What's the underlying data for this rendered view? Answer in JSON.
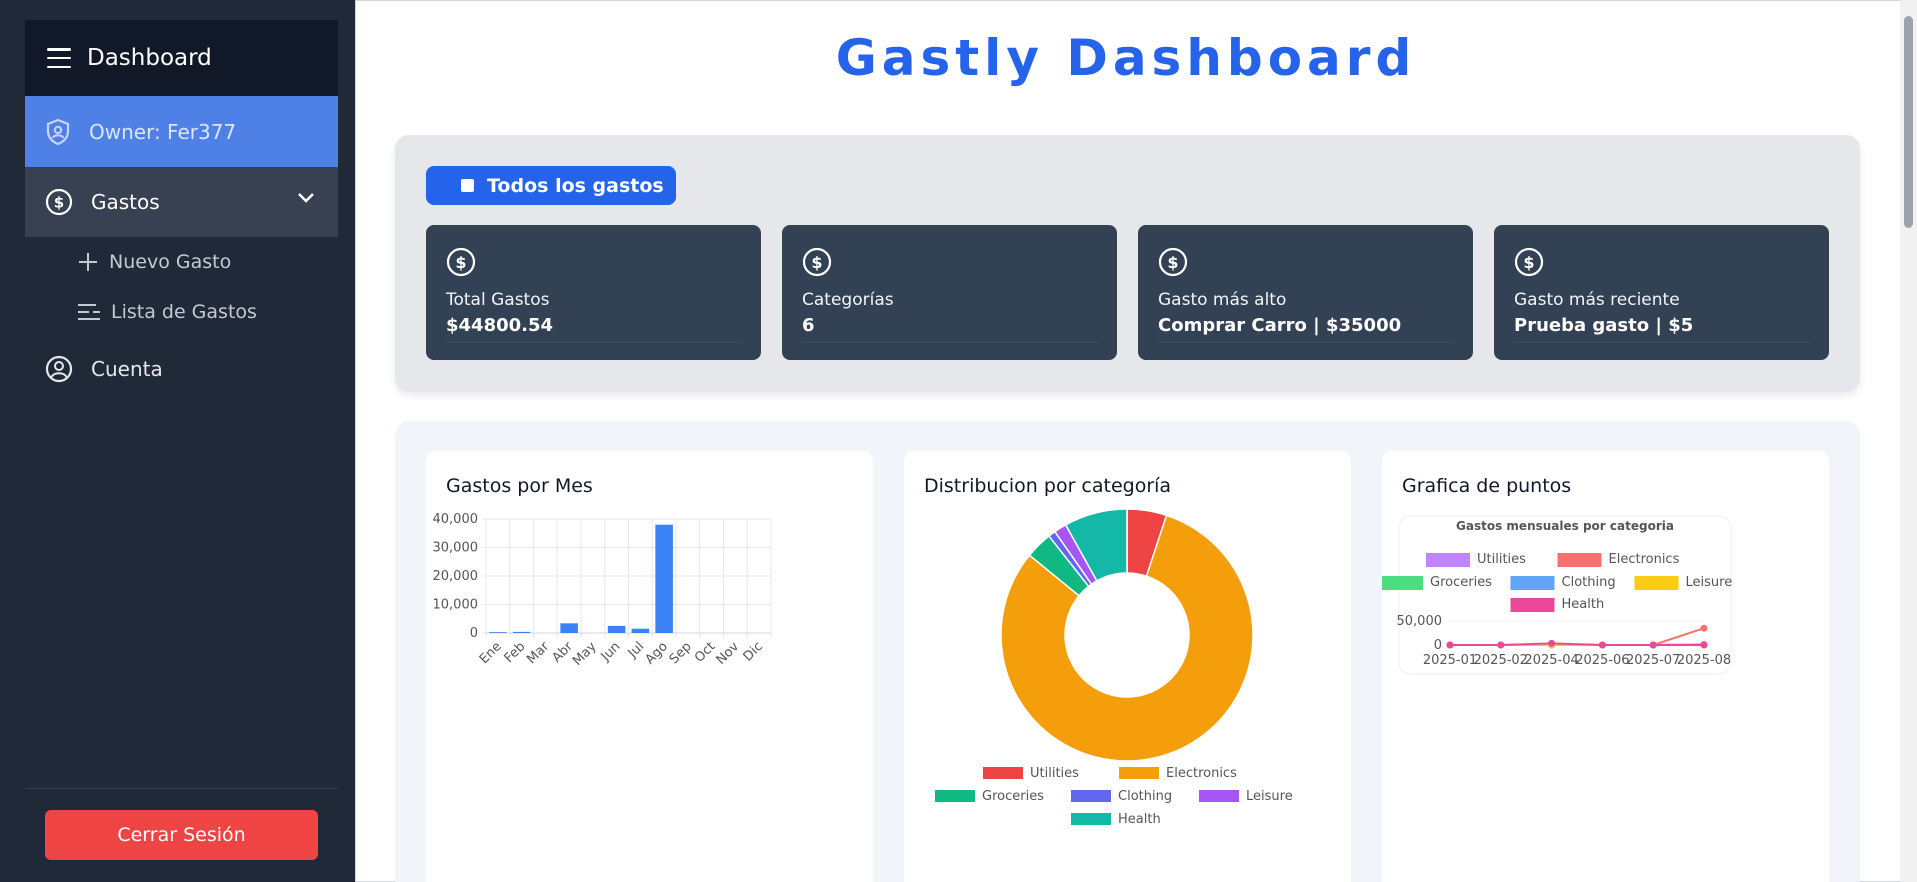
{
  "sidebar": {
    "header": "Dashboard",
    "owner": "Owner: Fer377",
    "gastos": "Gastos",
    "nuevo_gasto": "Nuevo Gasto",
    "lista_gastos": "Lista de Gastos",
    "cuenta": "Cuenta",
    "logout": "Cerrar Sesión"
  },
  "main": {
    "title": "Gastly Dashboard",
    "filter_button": "Todos los gastos",
    "cards": [
      {
        "label": "Total Gastos",
        "value": "$44800.54"
      },
      {
        "label": "Categorías",
        "value": "6"
      },
      {
        "label": "Gasto más alto",
        "value": "Comprar Carro | $35000"
      },
      {
        "label": "Gasto más reciente",
        "value": "Prueba gasto | $5"
      }
    ],
    "panels": [
      {
        "title": "Gastos por Mes"
      },
      {
        "title": "Distribucion por categoría"
      },
      {
        "title": "Grafica de puntos"
      }
    ]
  },
  "chart_data": [
    {
      "type": "bar",
      "title": "Gastos por Mes",
      "categories": [
        "Ene",
        "Feb",
        "Mar",
        "Abr",
        "May",
        "Jun",
        "Jul",
        "Ago",
        "Sep",
        "Oct",
        "Nov",
        "Dic"
      ],
      "values": [
        300,
        400,
        0,
        3400,
        0,
        2500,
        1500,
        38000,
        0,
        0,
        0,
        0
      ],
      "ylim": [
        0,
        40000
      ],
      "yticks": [
        0,
        10000,
        20000,
        30000,
        40000
      ],
      "ytick_labels": [
        "0",
        "10,000",
        "20,000",
        "30,000",
        "40,000"
      ],
      "color": "#3b82f6"
    },
    {
      "type": "pie",
      "title": "Distribucion por categoría",
      "labels": [
        "Utilities",
        "Electronics",
        "Groceries",
        "Clothing",
        "Leisure",
        "Health"
      ],
      "values": [
        2200,
        35000,
        1500,
        400,
        700,
        3500
      ],
      "colors": [
        "#ef4444",
        "#f59e0b",
        "#10b981",
        "#6366f1",
        "#a855f7",
        "#14b8a6"
      ]
    },
    {
      "type": "line",
      "title": "Gastos mensuales por categoria",
      "x": [
        "2025-01",
        "2025-02",
        "2025-04",
        "2025-06",
        "2025-07",
        "2025-08"
      ],
      "ylim": [
        0,
        50000
      ],
      "ytick_labels": [
        "0",
        "50,000"
      ],
      "series": [
        {
          "name": "Utilities",
          "values": [
            0,
            0,
            2000,
            0,
            0,
            500
          ],
          "color": "#c084fc"
        },
        {
          "name": "Electronics",
          "values": [
            0,
            0,
            0,
            0,
            0,
            35000
          ],
          "color": "#f87171"
        },
        {
          "name": "Groceries",
          "values": [
            0,
            0,
            0,
            0,
            0,
            1500
          ],
          "color": "#4ade80"
        },
        {
          "name": "Clothing",
          "values": [
            0,
            0,
            0,
            0,
            0,
            400
          ],
          "color": "#60a5fa"
        },
        {
          "name": "Leisure",
          "values": [
            0,
            0,
            0,
            0,
            0,
            700
          ],
          "color": "#facc15"
        },
        {
          "name": "Health",
          "values": [
            0,
            0,
            3500,
            0,
            0,
            0
          ],
          "color": "#ec4899"
        }
      ]
    }
  ]
}
